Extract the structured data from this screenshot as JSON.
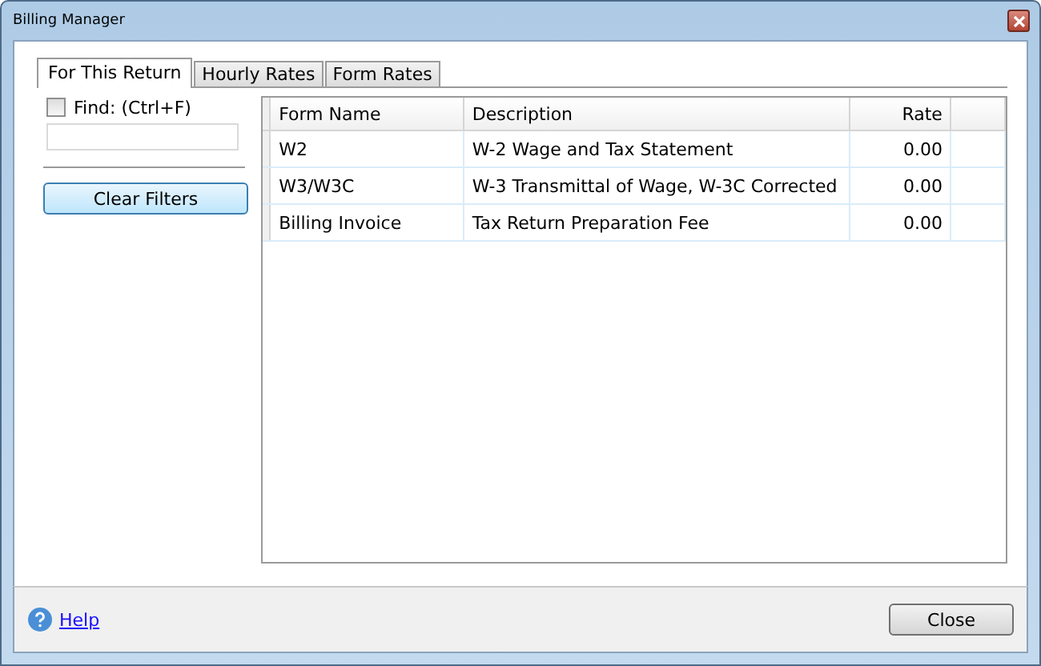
{
  "window": {
    "title": "Billing Manager"
  },
  "tabs": [
    {
      "label": "For This Return",
      "selected": true
    },
    {
      "label": "Hourly Rates",
      "selected": false
    },
    {
      "label": "Form Rates",
      "selected": false
    }
  ],
  "filter": {
    "find_label": "Find: (Ctrl+F)",
    "find_checked": false,
    "clear_button": "Clear Filters"
  },
  "table": {
    "columns": [
      "Form Name",
      "Description",
      "Rate"
    ],
    "rows": [
      [
        "W2",
        "W-2 Wage and Tax Statement",
        "0.00"
      ],
      [
        "W3/W3C",
        "W-3 Transmittal of Wage, W-3C Corrected",
        "0.00"
      ],
      [
        "Billing Invoice",
        "Tax Return Preparation Fee",
        "0.00"
      ]
    ]
  },
  "footer": {
    "help_link": "Help",
    "close_button": "Close"
  }
}
